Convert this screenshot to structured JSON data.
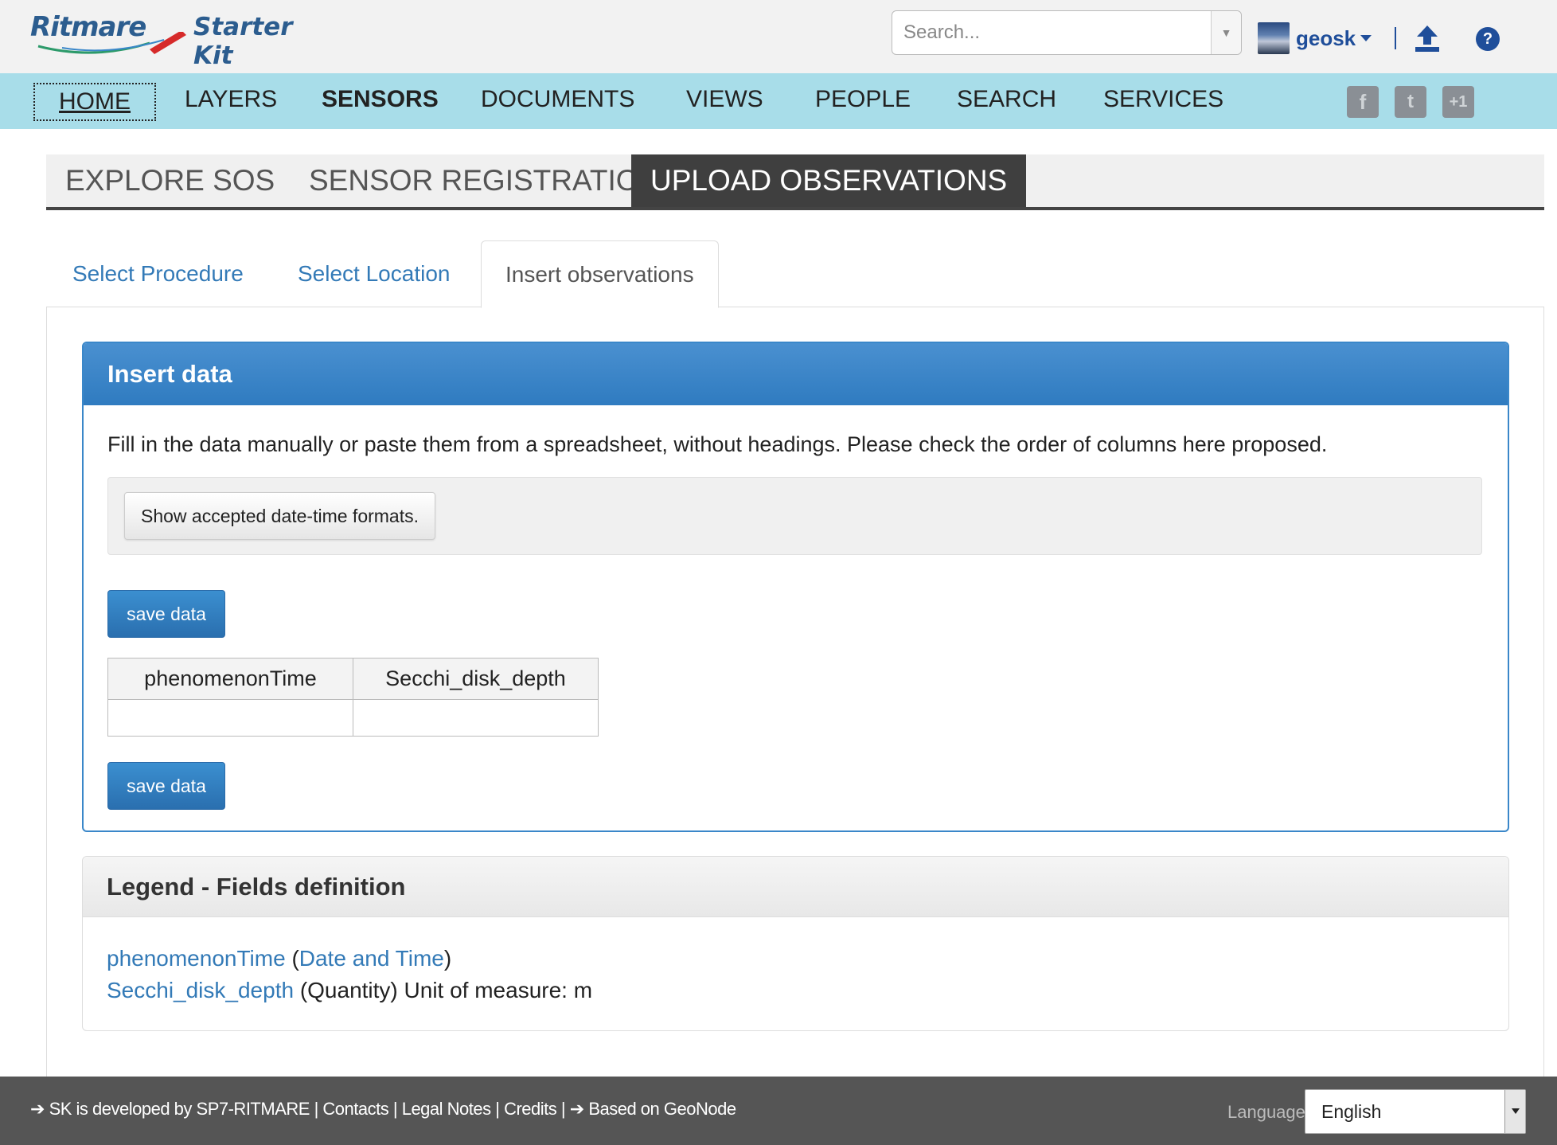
{
  "header": {
    "logo_brand": "Ritmare",
    "logo_product": "Starter Kit",
    "search_placeholder": "Search...",
    "username": "geosk"
  },
  "nav": {
    "items": [
      "HOME",
      "LAYERS",
      "SENSORS",
      "DOCUMENTS",
      "VIEWS",
      "PEOPLE",
      "SEARCH",
      "SERVICES"
    ],
    "social": [
      "facebook",
      "twitter",
      "+1"
    ]
  },
  "section_tabs": [
    "EXPLORE SOS",
    "SENSOR REGISTRATION",
    "UPLOAD OBSERVATIONS"
  ],
  "sub_tabs": [
    "Select Procedure",
    "Select Location",
    "Insert observations"
  ],
  "insert_panel": {
    "title": "Insert data",
    "intro": "Fill in the data manually or paste them from a spreadsheet, without headings. Please check the order of columns here proposed.",
    "formats_button": "Show accepted date-time formats.",
    "save_label": "save data",
    "columns": [
      "phenomenonTime",
      "Secchi_disk_depth"
    ]
  },
  "legend_panel": {
    "title": "Legend - Fields definition",
    "line1": {
      "field": "phenomenonTime",
      "open": "(",
      "type": "Date and Time",
      "close": ")"
    },
    "line2": {
      "field": "Secchi_disk_depth",
      "rest": "(Quantity) Unit of measure: m"
    }
  },
  "footer": {
    "developed_by": "SK is developed by SP7-RITMARE",
    "sep": "|",
    "contacts": "Contacts",
    "legal": "Legal Notes",
    "credits": "Credits",
    "based_on": "Based on GeoNode",
    "language_label": "Language",
    "language_value": "English"
  },
  "colors": {
    "navbar": "#a8dde9",
    "primary": "#337ab7",
    "footer": "#555555",
    "active_tab": "#3f3f3f"
  }
}
